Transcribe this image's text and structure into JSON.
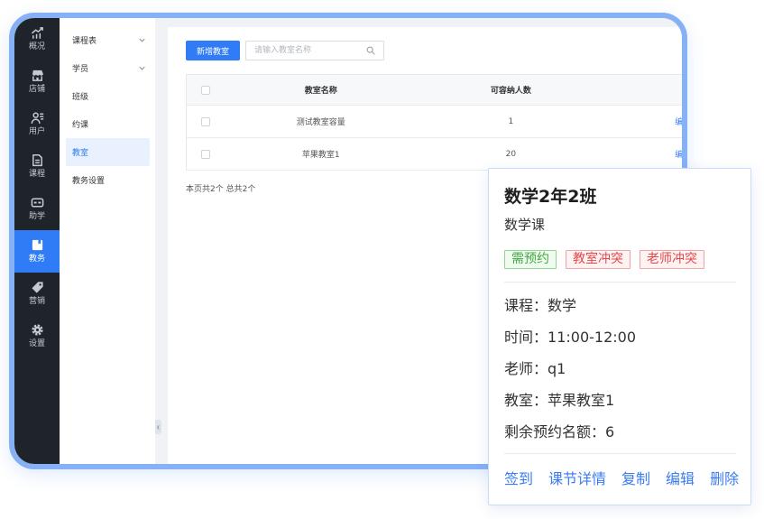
{
  "theme": {
    "frame_border": "#86b1f5",
    "sidebar_bg": "#1f232a",
    "accent": "#2f7cf6",
    "link": "#3a7cf0"
  },
  "main_nav": {
    "items": [
      {
        "label": "概况",
        "icon": "overview-chart-icon",
        "active": false
      },
      {
        "label": "店铺",
        "icon": "shop-icon",
        "active": false
      },
      {
        "label": "用户",
        "icon": "users-icon",
        "active": false
      },
      {
        "label": "课程",
        "icon": "course-doc-icon",
        "active": false
      },
      {
        "label": "助学",
        "icon": "gamepad-icon",
        "active": false
      },
      {
        "label": "教务",
        "icon": "academic-affairs-icon",
        "active": true
      },
      {
        "label": "营销",
        "icon": "tag-icon",
        "active": false
      },
      {
        "label": "设置",
        "icon": "gear-icon",
        "active": false
      }
    ]
  },
  "sub_nav": {
    "items": [
      {
        "label": "课程表",
        "expandable": true,
        "active": false
      },
      {
        "label": "学员",
        "expandable": true,
        "active": false
      },
      {
        "label": "班级",
        "expandable": false,
        "active": false
      },
      {
        "label": "约课",
        "expandable": false,
        "active": false
      },
      {
        "label": "教室",
        "expandable": false,
        "active": true
      },
      {
        "label": "教务设置",
        "expandable": false,
        "active": false
      }
    ],
    "collapse_icon": "chevron-left-icon"
  },
  "toolbar": {
    "add_button_label": "新增教室",
    "search_placeholder": "请输入教室名称",
    "search_icon": "search-icon"
  },
  "classroom_table": {
    "columns": [
      "教室名称",
      "可容纳人数"
    ],
    "rows": [
      {
        "name": "测试教室容量",
        "capacity": 1,
        "action": "编辑"
      },
      {
        "name": "苹果教室1",
        "capacity": 20,
        "action": "编辑"
      }
    ]
  },
  "pagination": {
    "summary": "本页共2个 总共2个"
  },
  "lesson_popup": {
    "title": "数学2年2班",
    "subtitle": "数学课",
    "tags": [
      {
        "label": "需预约",
        "color": "#43a843",
        "bg": "#f0fbef",
        "border": "#93d693"
      },
      {
        "label": "教室冲突",
        "color": "#e0484a",
        "bg": "#fff2f2",
        "border": "#f2a5a5"
      },
      {
        "label": "老师冲突",
        "color": "#e0484a",
        "bg": "#fff2f2",
        "border": "#f2a5a5"
      }
    ],
    "details": [
      {
        "label": "课程：",
        "value": "数学"
      },
      {
        "label": "时间：",
        "value": "11:00-12:00"
      },
      {
        "label": "老师：",
        "value": "q1"
      },
      {
        "label": "教室：",
        "value": "苹果教室1"
      },
      {
        "label": "剩余预约名额：",
        "value": 6
      }
    ],
    "actions": [
      "签到",
      "课节详情",
      "复制",
      "编辑",
      "删除"
    ]
  }
}
